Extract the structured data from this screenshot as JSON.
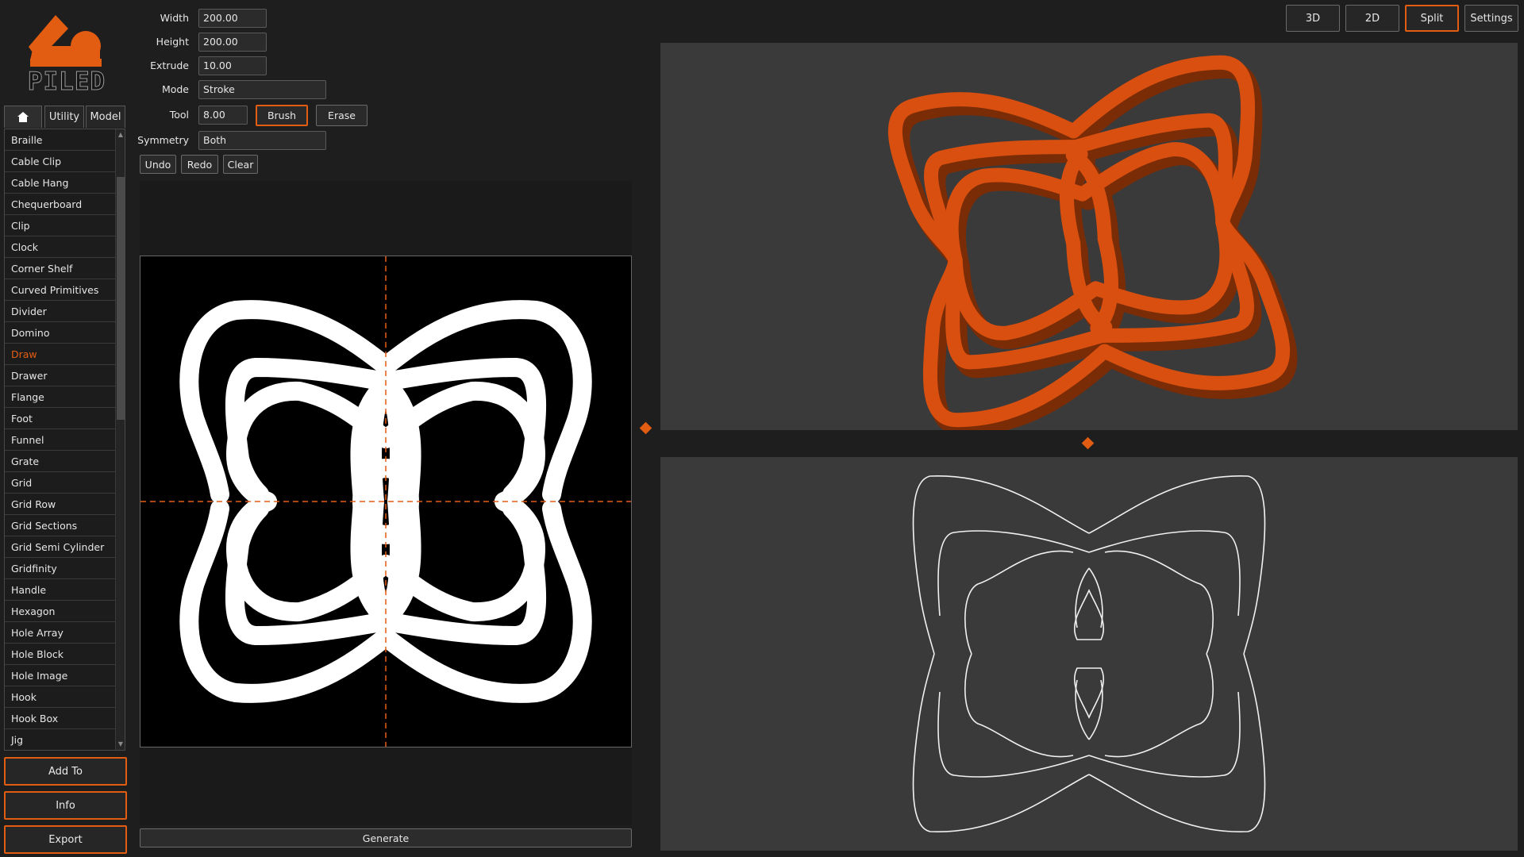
{
  "app": {
    "logo_text": "PILED",
    "accent_color": "#e25d12"
  },
  "tabs": [
    {
      "label": "",
      "icon": "home-icon"
    },
    {
      "label": "Utility"
    },
    {
      "label": "Model"
    }
  ],
  "model_list": {
    "items": [
      "Braille",
      "Cable Clip",
      "Cable Hang",
      "Chequerboard",
      "Clip",
      "Clock",
      "Corner Shelf",
      "Curved Primitives",
      "Divider",
      "Domino",
      "Draw",
      "Drawer",
      "Flange",
      "Foot",
      "Funnel",
      "Grate",
      "Grid",
      "Grid Row",
      "Grid Sections",
      "Grid Semi Cylinder",
      "Gridfinity",
      "Handle",
      "Hexagon",
      "Hole Array",
      "Hole Block",
      "Hole Image",
      "Hook",
      "Hook Box",
      "Jig"
    ],
    "selected": "Draw"
  },
  "side_buttons": {
    "add_to": "Add To",
    "info": "Info",
    "export": "Export"
  },
  "params": {
    "width": {
      "label": "Width",
      "value": "200.00"
    },
    "height": {
      "label": "Height",
      "value": "200.00"
    },
    "extrude": {
      "label": "Extrude",
      "value": "10.00"
    },
    "mode": {
      "label": "Mode",
      "value": "Stroke"
    },
    "tool": {
      "label": "Tool",
      "value": "8.00"
    },
    "symmetry": {
      "label": "Symmetry",
      "value": "Both"
    }
  },
  "tool_buttons": {
    "brush": "Brush",
    "erase": "Erase"
  },
  "history_buttons": {
    "undo": "Undo",
    "redo": "Redo",
    "clear": "Clear"
  },
  "generate_label": "Generate",
  "view_buttons": {
    "b3d": "3D",
    "b2d": "2D",
    "split": "Split",
    "settings": "Settings",
    "active": "Split"
  }
}
